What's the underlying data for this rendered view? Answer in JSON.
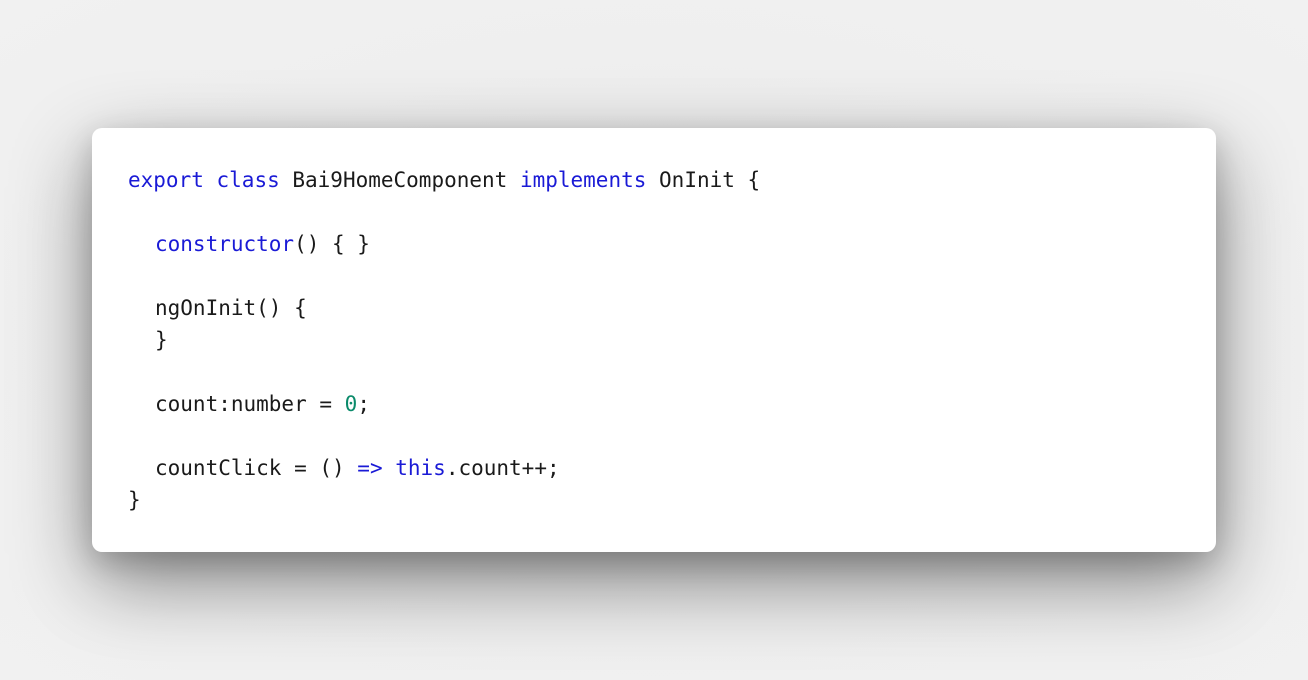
{
  "code": {
    "line1": {
      "t1": "export",
      "t2": " ",
      "t3": "class",
      "t4": " Bai9HomeComponent ",
      "t5": "implements",
      "t6": " OnInit {"
    },
    "line3": {
      "t1": "constructor",
      "t2": "() { }"
    },
    "line5": {
      "t1": "ngOnInit() {"
    },
    "line6": {
      "t1": "}"
    },
    "line8": {
      "t1": "count:number = ",
      "t2": "0",
      "t3": ";"
    },
    "line10": {
      "t1": "countClick = () ",
      "t2": "=>",
      "t3": " ",
      "t4": "this",
      "t5": ".count++;"
    },
    "line11": {
      "t1": "}"
    }
  },
  "colors": {
    "keyword": "#1a1ad6",
    "number": "#0a8a6a",
    "text": "#1a1a1a",
    "card_background": "#ffffff",
    "page_background": "#ececec"
  }
}
